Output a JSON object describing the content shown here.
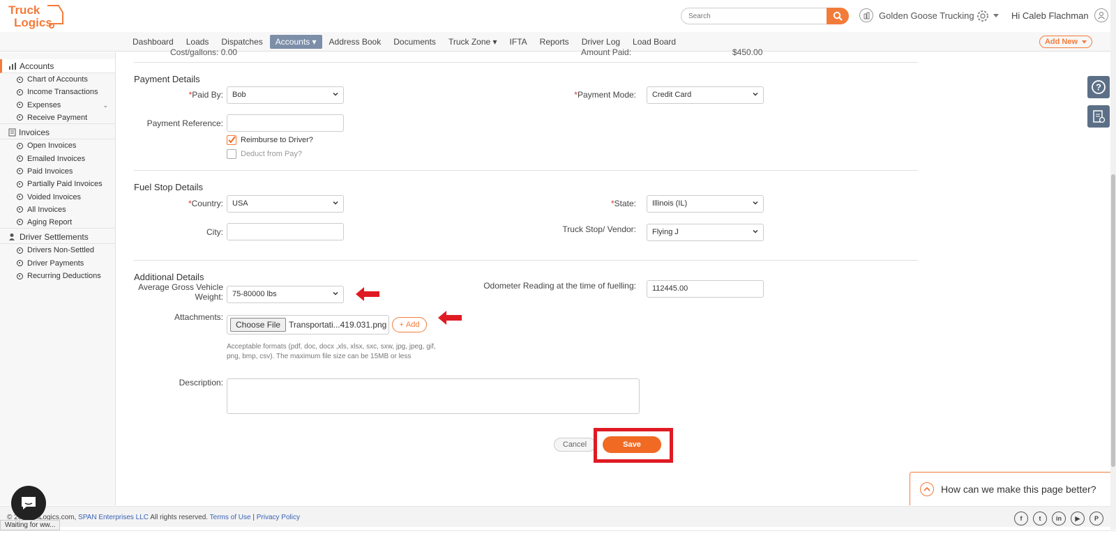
{
  "app": {
    "logo_text_1": "Truck",
    "logo_text_2": "Logics",
    "brand_color": "#f37b3a"
  },
  "header": {
    "search_placeholder": "Search",
    "company": "Golden Goose Trucking",
    "greeting": "Hi Caleb Flachman"
  },
  "nav": {
    "items": [
      "Dashboard",
      "Loads",
      "Dispatches",
      "Accounts",
      "Address Book",
      "Documents",
      "Truck Zone",
      "IFTA",
      "Reports",
      "Driver Log",
      "Load Board"
    ],
    "add_new": "Add New"
  },
  "sidebar": {
    "accounts": "Accounts",
    "accounts_items": [
      "Chart of Accounts",
      "Income Transactions",
      "Expenses",
      "Receive Payment"
    ],
    "invoices": "Invoices",
    "invoices_items": [
      "Open Invoices",
      "Emailed Invoices",
      "Paid Invoices",
      "Partially Paid Invoices",
      "Voided Invoices",
      "All Invoices",
      "Aging Report"
    ],
    "settlements": "Driver Settlements",
    "settlements_items": [
      "Drivers Non-Settled",
      "Driver Payments",
      "Recurring Deductions"
    ]
  },
  "top_partial": {
    "left": "Cost/gallons:",
    "left_value": "0.00",
    "right": "Amount Paid:",
    "right_value": "$450.00"
  },
  "payment": {
    "title": "Payment Details",
    "paid_by_label": "Paid By:",
    "paid_by_value": "Bob",
    "payment_mode_label": "Payment Mode:",
    "payment_mode_value": "Credit Card",
    "reference_label": "Payment Reference:",
    "reference_value": "",
    "reimburse_label": "Reimburse to Driver?",
    "deduct_label": "Deduct from Pay?"
  },
  "fuel": {
    "title": "Fuel Stop Details",
    "country_label": "Country:",
    "country_value": "USA",
    "state_label": "State:",
    "state_value": "Illinois (IL)",
    "city_label": "City:",
    "city_value": "",
    "vendor_label": "Truck Stop/ Vendor:",
    "vendor_value": "Flying J"
  },
  "additional": {
    "title": "Additional Details",
    "gvw_label_1": "Average Gross Vehicle",
    "gvw_label_2": "Weight:",
    "gvw_value": "75-80000 lbs",
    "odometer_label": "Odometer Reading at the time of fuelling:",
    "odometer_value": "112445.00",
    "attachments_label": "Attachments:",
    "choose_file": "Choose File",
    "file_name": "Transportati...419.031.png",
    "add_label": "Add",
    "hint": "Acceptable formats (pdf, doc, docx ,xls, xlsx, sxc, sxw, jpg, jpeg, gif, png, bmp, csv). The maximum file size can be 15MB or less",
    "description_label": "Description:"
  },
  "actions": {
    "cancel": "Cancel",
    "save": "Save"
  },
  "feedback": "How can we make this page better?",
  "footer": {
    "prefix": "© 20",
    "mid": "TruckLogics.com, ",
    "span": "SPAN Enterprises LLC",
    "rights": " All rights reserved. ",
    "terms": "Terms of Use",
    "sep": " | ",
    "privacy": "Privacy Policy"
  },
  "status_text": "Waiting for ww..."
}
